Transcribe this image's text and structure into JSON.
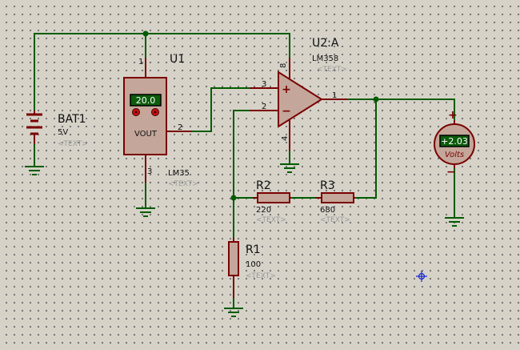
{
  "components": {
    "bat1": {
      "ref": "BAT1",
      "value": "5V",
      "text": "<TEXT>"
    },
    "u1": {
      "ref": "U1",
      "part": "LM35",
      "text": "<TEXT>",
      "display": "20.0",
      "pin_label": "VOUT",
      "pins": [
        "1",
        "2",
        "3"
      ]
    },
    "u2": {
      "ref": "U2:A",
      "part": "LM358",
      "text": "<TEXT>",
      "pins": [
        "8",
        "3",
        "2",
        "4",
        "1"
      ],
      "plus": "+",
      "minus": "−"
    },
    "r1": {
      "ref": "R1",
      "value": "100",
      "text": "<TEXT>"
    },
    "r2": {
      "ref": "R2",
      "value": "220",
      "text": "<TEXT>"
    },
    "r3": {
      "ref": "R3",
      "value": "680",
      "text": "<TEXT>"
    },
    "voltmeter": {
      "reading": "+2.03",
      "unit": "Volts",
      "plus": "+",
      "minus": "−"
    }
  },
  "colors": {
    "wire": "#005c00",
    "component": "#7a0000",
    "body_fill": "#c4a79a",
    "background": "#d6d2c8"
  }
}
